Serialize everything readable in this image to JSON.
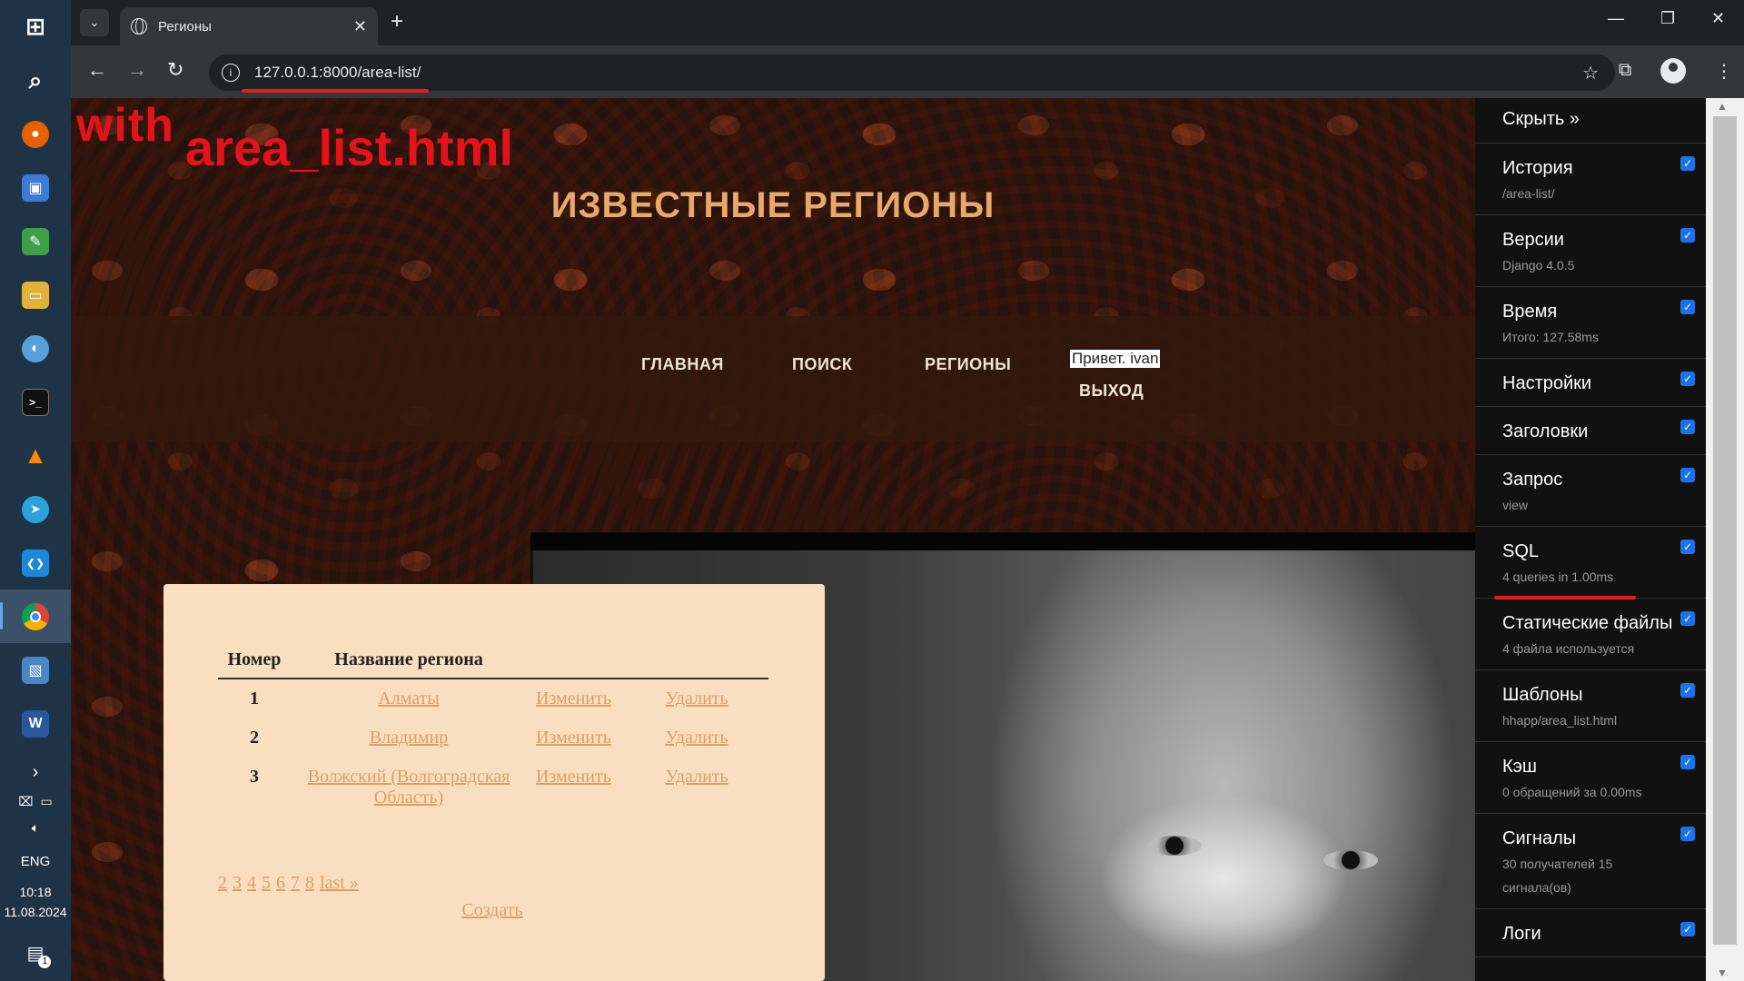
{
  "taskbar": {
    "apps": [
      {
        "name": "start",
        "glyph": "⊞",
        "color": "#1f3346"
      },
      {
        "name": "search",
        "glyph": "⌕",
        "color": "#1f3346"
      },
      {
        "name": "firefox",
        "glyph": "●",
        "color": "#e66000"
      },
      {
        "name": "save-app",
        "glyph": "▣",
        "color": "#3a7bd5"
      },
      {
        "name": "notepad-app",
        "glyph": "✎",
        "color": "#3f9e4a"
      },
      {
        "name": "explorer",
        "glyph": "▭",
        "color": "#e0b23c"
      },
      {
        "name": "paint",
        "glyph": "◐",
        "color": "#5aa0d8"
      },
      {
        "name": "terminal",
        "glyph": ">_",
        "color": "#111111"
      },
      {
        "name": "vlc",
        "glyph": "▲",
        "color": "#ff8800"
      },
      {
        "name": "telegram",
        "glyph": "➤",
        "color": "#2aa3dd"
      },
      {
        "name": "vscode",
        "glyph": "❮❯",
        "color": "#1e88d8"
      },
      {
        "name": "chrome",
        "glyph": "◉",
        "color": "#db4437"
      },
      {
        "name": "photos",
        "glyph": "▧",
        "color": "#4a86c5"
      },
      {
        "name": "word",
        "glyph": "W",
        "color": "#2b579a"
      }
    ],
    "lang": "ENG",
    "time": "10:18",
    "date": "11.08.2024",
    "notif_count": "1"
  },
  "browser": {
    "tab_title": "Регионы",
    "url": "127.0.0.1:8000/area-list/"
  },
  "page": {
    "annotation_with": "with",
    "annotation_file": "area_list.html",
    "title": "ИЗВЕСТНЫЕ РЕГИОНЫ",
    "nav": {
      "home": "ГЛАВНАЯ",
      "search": "ПОИСК",
      "regions": "РЕГИОНЫ",
      "greeting": "Привет. ivan",
      "logout": "ВЫХОД"
    },
    "table": {
      "headers": {
        "num": "Номер",
        "name": "Название региона"
      },
      "rows": [
        {
          "num": "1",
          "name": "Алматы",
          "edit": "Изменить",
          "delete": "Удалить"
        },
        {
          "num": "2",
          "name": "Владимир",
          "edit": "Изменить",
          "delete": "Удалить"
        },
        {
          "num": "3",
          "name": "Волжский (Волгоградская Область)",
          "edit": "Изменить",
          "delete": "Удалить"
        }
      ]
    },
    "pagination": [
      "2",
      "3",
      "4",
      "5",
      "6",
      "7",
      "8"
    ],
    "last_label": "last »",
    "create_label": "Создать"
  },
  "debug_toolbar": {
    "hide_label": "Скрыть »",
    "panels": [
      {
        "title": "История",
        "subtitle": "/area-list/"
      },
      {
        "title": "Версии",
        "subtitle": "Django 4.0.5"
      },
      {
        "title": "Время",
        "subtitle": "Итого: 127.58ms"
      },
      {
        "title": "Настройки",
        "subtitle": ""
      },
      {
        "title": "Заголовки",
        "subtitle": ""
      },
      {
        "title": "Запрос",
        "subtitle": "view"
      },
      {
        "title": "SQL",
        "subtitle": "4 queries in 1.00ms"
      },
      {
        "title": "Статические файлы",
        "subtitle": "4 файла используется"
      },
      {
        "title": "Шаблоны",
        "subtitle": "hhapp/area_list.html"
      },
      {
        "title": "Кэш",
        "subtitle": "0 обращений за 0.00ms"
      },
      {
        "title": "Сигналы",
        "subtitle": "30 получателей 15 сигнала(ов)"
      },
      {
        "title": "Логи",
        "subtitle": ""
      }
    ]
  }
}
